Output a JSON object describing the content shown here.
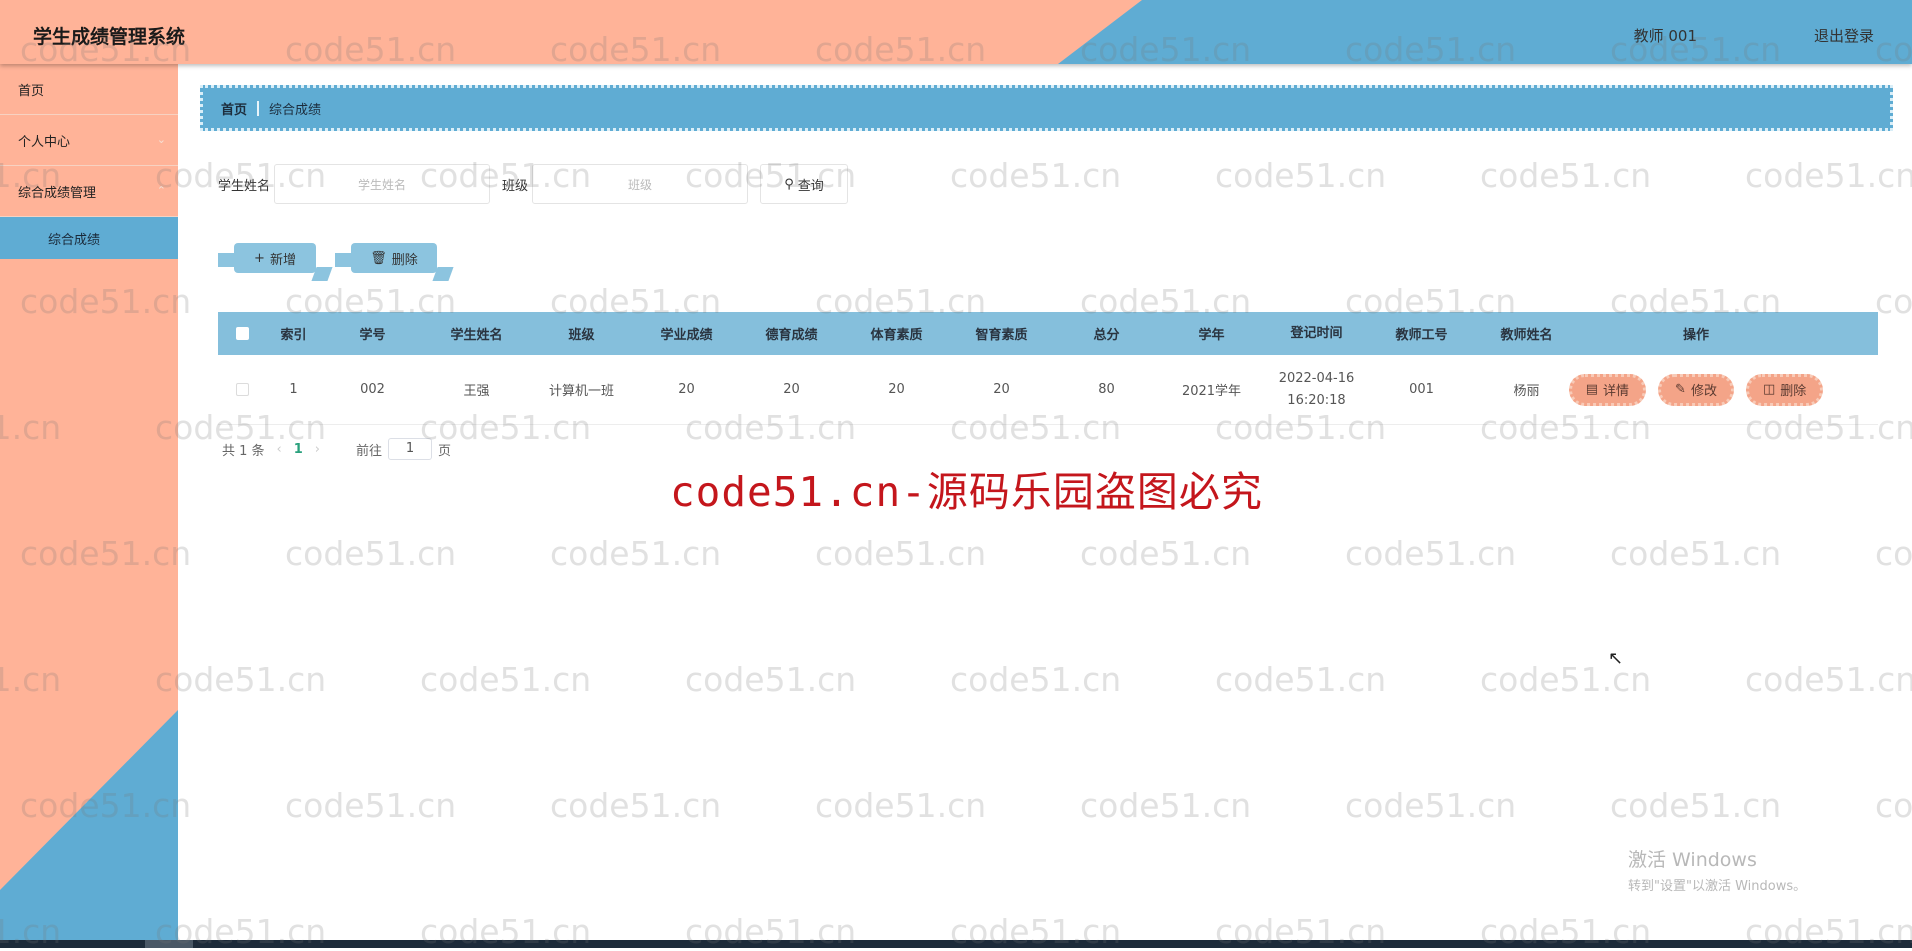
{
  "header": {
    "title": "学生成绩管理系统",
    "user": "教师 001",
    "logout": "退出登录",
    "colors": {
      "salmon": "#FFB398",
      "blue": "#5FACD3"
    }
  },
  "sidebar": {
    "items": [
      {
        "label": "首页",
        "has_arrow": false
      },
      {
        "label": "个人中心",
        "has_arrow": true
      },
      {
        "label": "综合成绩管理",
        "has_arrow": true
      }
    ],
    "active_sub": "综合成绩"
  },
  "breadcrumb": {
    "home": "首页",
    "current": "综合成绩"
  },
  "search": {
    "name_label": "学生姓名",
    "name_placeholder": "学生姓名",
    "class_label": "班级",
    "class_placeholder": "班级",
    "query_button": "查询"
  },
  "toolbar": {
    "add": "新增",
    "delete": "删除"
  },
  "table": {
    "headers": [
      "索引",
      "学号",
      "学生姓名",
      "班级",
      "学业成绩",
      "德育成绩",
      "体育素质",
      "智育素质",
      "总分",
      "学年",
      "登记时间",
      "教师工号",
      "教师姓名",
      "操作"
    ],
    "rows": [
      {
        "index": "1",
        "student_no": "002",
        "name": "王强",
        "class": "计算机一班",
        "academic": "20",
        "moral": "20",
        "physical": "20",
        "intellectual": "20",
        "total": "80",
        "year": "2021学年",
        "reg_date": "2022-04-16",
        "reg_time": "16:20:18",
        "teacher_no": "001",
        "teacher_name": "杨丽",
        "actions": {
          "detail": "详情",
          "edit": "修改",
          "delete": "删除"
        }
      }
    ]
  },
  "pagination": {
    "total": "共 1 条",
    "current": "1",
    "goto": "前往",
    "page_input": "1",
    "page_suffix": "页"
  },
  "watermark": {
    "text": "code51.cn",
    "red_text": "code51.cn-源码乐园盗图必究"
  },
  "windows_activation": {
    "line1": "激活 Windows",
    "line2": "转到\"设置\"以激活 Windows。"
  }
}
